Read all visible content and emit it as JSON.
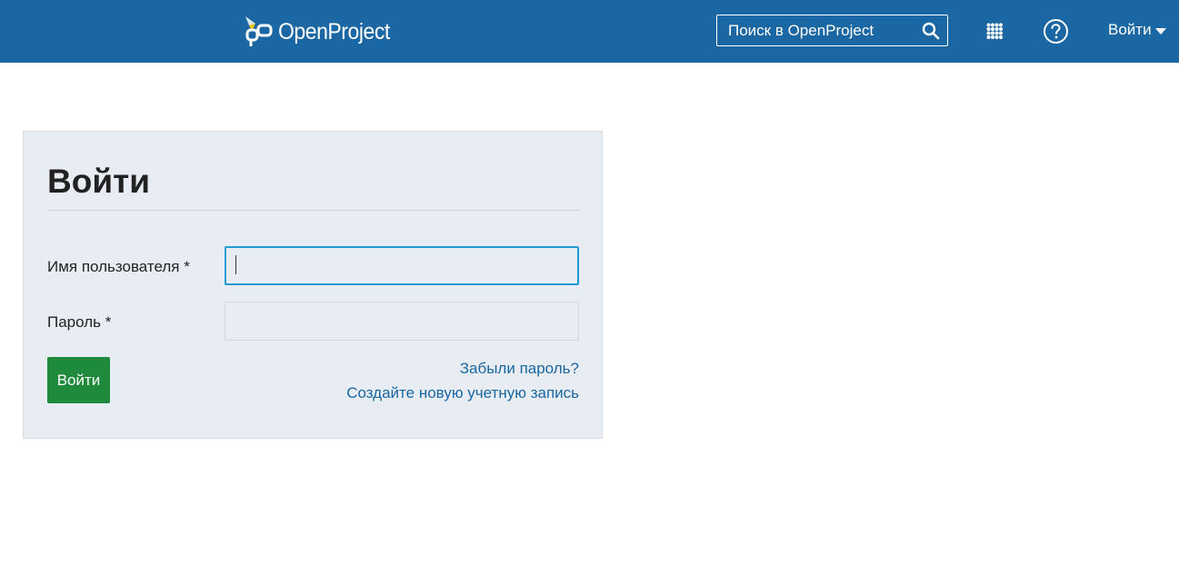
{
  "header": {
    "logo_text": "OpenProject",
    "search_placeholder": "Поиск в OpenProject",
    "login_menu_label": "Войти",
    "colors": {
      "topbar": "#1a67a3",
      "logo_accent_yellow": "#f2c300"
    }
  },
  "login_form": {
    "title": "Войти",
    "username_label": "Имя пользователя *",
    "username_value": "",
    "password_label": "Пароль *",
    "password_value": "",
    "submit_label": "Войти",
    "forgot_password_link": "Забыли пароль?",
    "register_link": "Создайте новую учетную запись",
    "colors": {
      "panel_bg": "#e8ecf3",
      "submit_bg": "#208a3c",
      "link": "#1a67a3",
      "focus_border": "#1f9ad6"
    }
  }
}
